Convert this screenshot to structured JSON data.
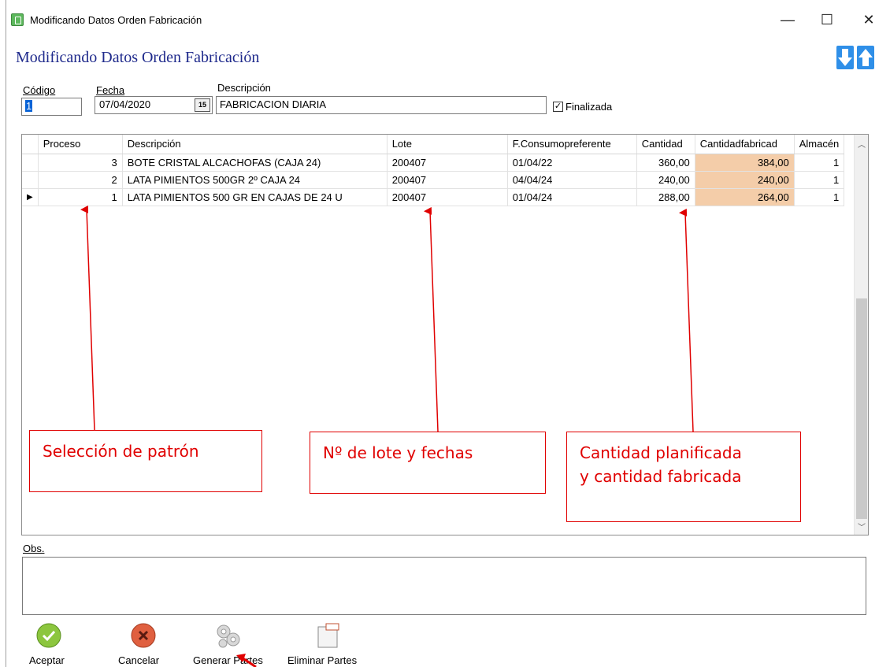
{
  "window": {
    "title": "Modificando Datos Orden Fabricación",
    "minimize_glyph": "—",
    "maximize_glyph": "☐",
    "close_glyph": "✕"
  },
  "header": {
    "heading": "Modificando Datos Orden Fabricación"
  },
  "form": {
    "codigo_label": "Código",
    "codigo_value": "1",
    "fecha_label": "Fecha",
    "fecha_value": "07/04/2020",
    "calendar_glyph": "15",
    "descripcion_label": "Descripción",
    "descripcion_value": "FABRICACION DIARIA",
    "finalizada_label": "Finalizada",
    "finalizada_checked": true
  },
  "grid": {
    "columns": [
      "",
      "Proceso",
      "Descripción",
      "Lote",
      "F.Consumopreferente",
      "Cantidad",
      "Cantidadfabricad",
      "Almacén"
    ],
    "rows": [
      {
        "indicator": "",
        "proceso": "3",
        "descripcion": "BOTE CRISTAL ALCACHOFAS (CAJA 24)",
        "lote": "200407",
        "fcp": "01/04/22",
        "cantidad": "360,00",
        "fabricada": "384,00",
        "almacen": "1"
      },
      {
        "indicator": "",
        "proceso": "2",
        "descripcion": "LATA PIMIENTOS 500GR 2º CAJA 24",
        "lote": "200407",
        "fcp": "04/04/24",
        "cantidad": "240,00",
        "fabricada": "240,00",
        "almacen": "1"
      },
      {
        "indicator": "▶",
        "proceso": "1",
        "descripcion": "LATA PIMIENTOS 500 GR EN CAJAS DE 24 U",
        "lote": "200407",
        "fcp": "01/04/24",
        "cantidad": "288,00",
        "fabricada": "264,00",
        "almacen": "1"
      }
    ],
    "highlight_color": "#f4cda9"
  },
  "obs": {
    "label": "Obs.",
    "value": ""
  },
  "buttons": {
    "aceptar": "Aceptar",
    "cancelar": "Cancelar",
    "generar": "Generar Partes",
    "eliminar": "Eliminar Partes"
  },
  "annotations": {
    "patron": "Selección de patrón",
    "lote": "Nº de lote y fechas",
    "cantidad_line1": "Cantidad planificada",
    "cantidad_line2": "y cantidad fabricada",
    "color": "#e00000"
  }
}
